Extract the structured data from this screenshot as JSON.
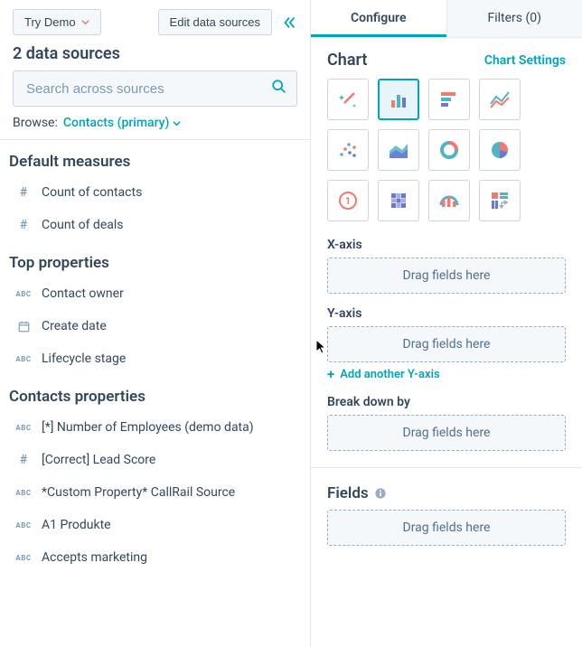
{
  "left": {
    "try_demo_label": "Try Demo",
    "edit_sources_label": "Edit data sources",
    "data_sources_label": "2 data sources",
    "search_placeholder": "Search across sources",
    "browse_label": "Browse:",
    "browse_value": "Contacts (primary)",
    "sections": {
      "default_measures": {
        "title": "Default measures",
        "items": [
          {
            "type": "number",
            "label": "Count of contacts"
          },
          {
            "type": "number",
            "label": "Count of deals"
          }
        ]
      },
      "top_properties": {
        "title": "Top properties",
        "items": [
          {
            "type": "text",
            "label": "Contact owner"
          },
          {
            "type": "date",
            "label": "Create date"
          },
          {
            "type": "text",
            "label": "Lifecycle stage"
          }
        ]
      },
      "contacts_properties": {
        "title": "Contacts properties",
        "items": [
          {
            "type": "text",
            "label": "[*] Number of Employees (demo data)"
          },
          {
            "type": "number",
            "label": "[Correct] Lead Score"
          },
          {
            "type": "text",
            "label": "*Custom Property* CallRail Source"
          },
          {
            "type": "text",
            "label": "A1 Produkte"
          },
          {
            "type": "text",
            "label": "Accepts marketing"
          }
        ]
      }
    }
  },
  "right": {
    "tabs": {
      "configure": "Configure",
      "filters": "Filters (0)"
    },
    "chart_heading": "Chart",
    "chart_settings": "Chart Settings",
    "chart_types": [
      {
        "id": "magic",
        "glyph": "magic",
        "selected": false
      },
      {
        "id": "bar",
        "glyph": "bar",
        "selected": true
      },
      {
        "id": "hbar",
        "glyph": "hbar",
        "selected": false
      },
      {
        "id": "line",
        "glyph": "line",
        "selected": false
      },
      {
        "id": "scatter",
        "glyph": "scatter",
        "selected": false
      },
      {
        "id": "area",
        "glyph": "area",
        "selected": false
      },
      {
        "id": "donut",
        "glyph": "donut",
        "selected": false
      },
      {
        "id": "pie",
        "glyph": "pie",
        "selected": false
      },
      {
        "id": "kpi",
        "glyph": "kpi",
        "selected": false
      },
      {
        "id": "heat",
        "glyph": "heat",
        "selected": false
      },
      {
        "id": "gauge",
        "glyph": "gauge",
        "selected": false
      },
      {
        "id": "pivot",
        "glyph": "pivot",
        "selected": false
      }
    ],
    "x_axis_label": "X-axis",
    "y_axis_label": "Y-axis",
    "breakdown_label": "Break down by",
    "fields_label": "Fields",
    "drop_placeholder": "Drag fields here",
    "add_y_axis": "Add another Y-axis"
  }
}
